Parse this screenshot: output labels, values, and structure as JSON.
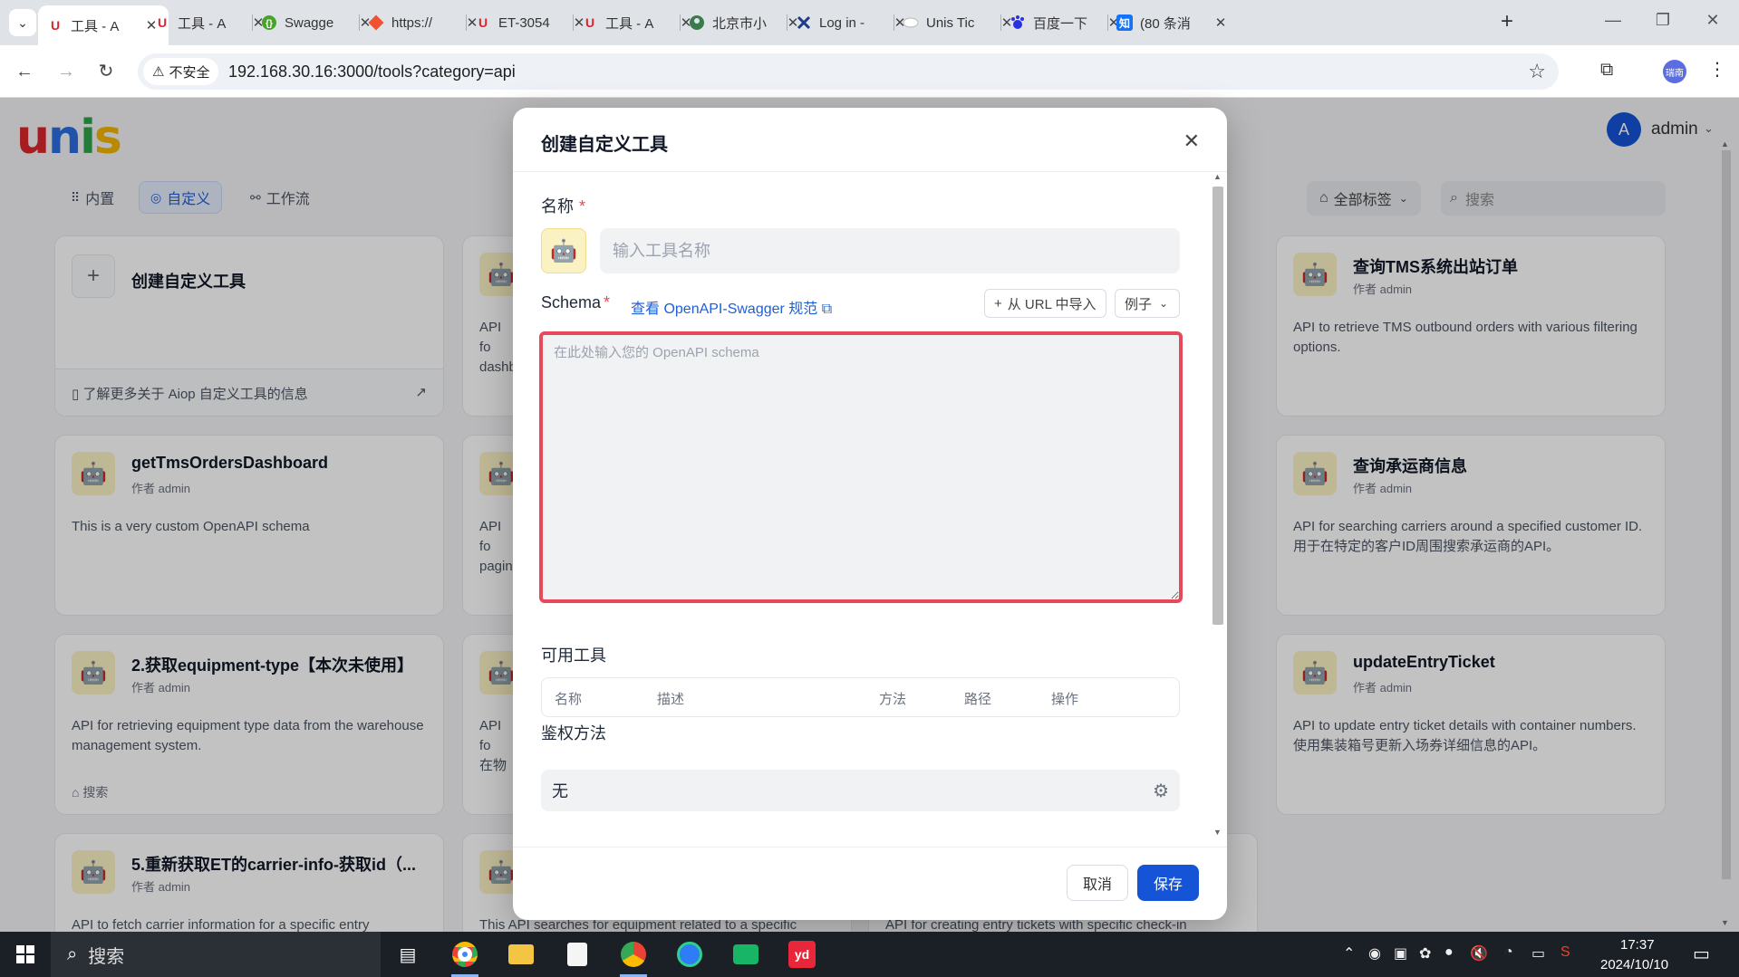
{
  "browser": {
    "tabs": [
      {
        "title": "工具 - A",
        "favicon": "U",
        "fav_color": "#d9262c"
      },
      {
        "title": "工具 - A",
        "favicon": "U",
        "fav_color": "#d9262c"
      },
      {
        "title": "Swagge",
        "favicon": "swagger-icon",
        "fav_color": "#49a32b"
      },
      {
        "title": "https://",
        "favicon": "git-icon",
        "fav_color": "#f05133"
      },
      {
        "title": "ET-3054",
        "favicon": "U",
        "fav_color": "#d9262c"
      },
      {
        "title": "工具 - A",
        "favicon": "U",
        "fav_color": "#d9262c"
      },
      {
        "title": "北京市小",
        "favicon": "globe-icon",
        "fav_color": "#3a7b4d"
      },
      {
        "title": "Log in -",
        "favicon": "jira-icon",
        "fav_color": "#1e3a8a"
      },
      {
        "title": "Unis Tic",
        "favicon": "ticket-icon",
        "fav_color": "#999999"
      },
      {
        "title": "百度一下",
        "favicon": "baidu-icon",
        "fav_color": "#2932e1"
      },
      {
        "title": "(80 条消",
        "favicon": "知",
        "fav_color": "#1772f6"
      }
    ],
    "new_tab": "+",
    "security_label": "不安全",
    "url": "192.168.30.16:3000/tools?category=api",
    "profile_initials": "瑞南"
  },
  "app": {
    "user_initial": "A",
    "user_name": "admin",
    "categories": [
      {
        "label": "内置",
        "icon": "grid-icon",
        "active": false
      },
      {
        "label": "自定义",
        "icon": "custom-icon",
        "active": true
      },
      {
        "label": "工作流",
        "icon": "workflow-icon",
        "active": false
      }
    ],
    "tag_filter": "全部标签",
    "search_placeholder": "搜索",
    "create_card": {
      "title": "创建自定义工具",
      "learn_more": "了解更多关于 Aiop 自定义工具的信息"
    },
    "cards": [
      {
        "title": "查询TMS系统出站订单",
        "author": "作者 admin",
        "desc": "API to retrieve TMS outbound orders with various filtering options.",
        "tag": ""
      },
      {
        "title": "getTmsOrdersDashboard",
        "author": "作者 admin",
        "desc": "This is a very custom OpenAPI schema",
        "tag": ""
      },
      {
        "title": "查询承运商信息",
        "author": "作者 admin",
        "desc": "API for searching carriers around a specified customer ID. 用于在特定的客户ID周围搜索承运商的API。",
        "tag": ""
      },
      {
        "title": "2.获取equipment-type【本次未使用】",
        "author": "作者 admin",
        "desc": "API for retrieving equipment type data from the warehouse management system.",
        "tag": "搜索"
      },
      {
        "title": "updateEntryTicket",
        "author": "作者 admin",
        "desc": "API to update entry ticket details with container numbers. 使用集装箱号更新入场券详细信息的API。",
        "tag": ""
      },
      {
        "title": "5.重新获取ET的carrier-info-获取id（...",
        "author": "作者 admin",
        "desc": "API to fetch carrier information for a specific entry",
        "tag": ""
      }
    ],
    "partial_cards": [
      {
        "desc": "API fo dashb"
      },
      {
        "desc": "API fo pagin"
      },
      {
        "desc": "API fo 在物"
      },
      {
        "desc": "This API searches for equipment related to a specific"
      },
      {
        "desc": "API for creating entry tickets with specific check-in"
      }
    ]
  },
  "modal": {
    "title": "创建自定义工具",
    "name_label": "名称",
    "name_placeholder": "输入工具名称",
    "schema_label": "Schema",
    "swagger_link": "查看 OpenAPI-Swagger 规范",
    "import_url": "从 URL 中导入",
    "example": "例子",
    "schema_placeholder": "在此处输入您的 OpenAPI schema",
    "available_tools_label": "可用工具",
    "table_headers": [
      "名称",
      "描述",
      "方法",
      "路径",
      "操作"
    ],
    "auth_label": "鉴权方法",
    "auth_value": "无",
    "cancel": "取消",
    "save": "保存"
  },
  "taskbar": {
    "search": "搜索",
    "time": "17:37",
    "date": "2024/10/10"
  },
  "colors": {
    "primary": "#1554d6",
    "error_border": "#e8485c",
    "icon_bg": "#fbf2c4"
  }
}
